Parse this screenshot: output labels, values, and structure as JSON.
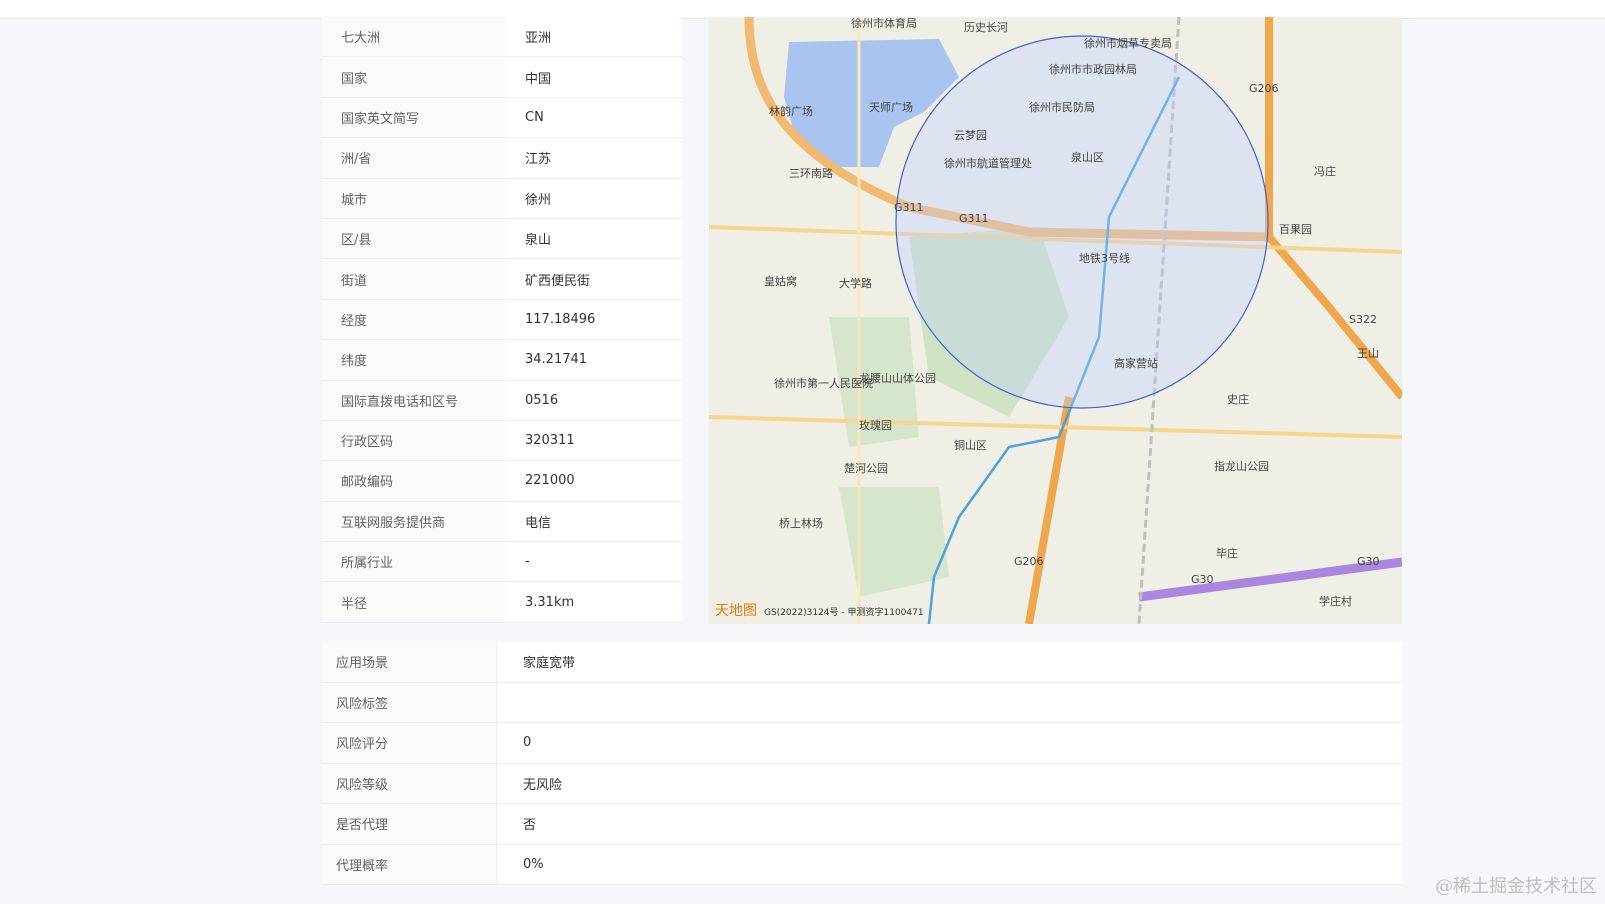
{
  "info_rows": [
    {
      "key": "七大洲",
      "value": "亚洲"
    },
    {
      "key": "国家",
      "value": "中国"
    },
    {
      "key": "国家英文简写",
      "value": "CN"
    },
    {
      "key": "洲/省",
      "value": "江苏"
    },
    {
      "key": "城市",
      "value": "徐州"
    },
    {
      "key": "区/县",
      "value": "泉山"
    },
    {
      "key": "街道",
      "value": "矿西便民街"
    },
    {
      "key": "经度",
      "value": "117.18496"
    },
    {
      "key": "纬度",
      "value": "34.21741"
    },
    {
      "key": "国际直拨电话和区号",
      "value": "0516"
    },
    {
      "key": "行政区码",
      "value": "320311"
    },
    {
      "key": "邮政编码",
      "value": "221000"
    },
    {
      "key": "互联网服务提供商",
      "value": "电信"
    },
    {
      "key": "所属行业",
      "value": "-"
    },
    {
      "key": "半径",
      "value": "3.31km"
    }
  ],
  "bottom_rows": [
    {
      "key": "应用场景",
      "value": "家庭宽带"
    },
    {
      "key": "风险标签",
      "value": ""
    },
    {
      "key": "风险评分",
      "value": "0"
    },
    {
      "key": "风险等级",
      "value": "无风险"
    },
    {
      "key": "是否代理",
      "value": "否"
    },
    {
      "key": "代理概率",
      "value": "0%"
    }
  ],
  "map": {
    "labels": [
      "徐州市体育局",
      "历史长河",
      "徐州市烟草专卖局",
      "徐州市市政园林局",
      "徐州市民防局",
      "林韵广场",
      "天师广场",
      "三环南路",
      "云梦园",
      "徐州市航道管理处",
      "泉山区",
      "冯庄",
      "百果园",
      "G311",
      "G311",
      "G206",
      "大学路",
      "皇姑窝",
      "地铁3号线",
      "王山",
      "S322",
      "高家营站",
      "徐州市第一人民医院",
      "龙腰山山体公园",
      "史庄",
      "玫瑰园",
      "铜山区",
      "楚河公园",
      "指龙山公园",
      "桥上林场",
      "毕庄",
      "G206",
      "G30",
      "G30",
      "学庄村"
    ],
    "credit": "GS(2022)3124号 - 甲测资字1100471",
    "logo_text": "天地图"
  },
  "watermark": "@稀土掘金技术社区"
}
